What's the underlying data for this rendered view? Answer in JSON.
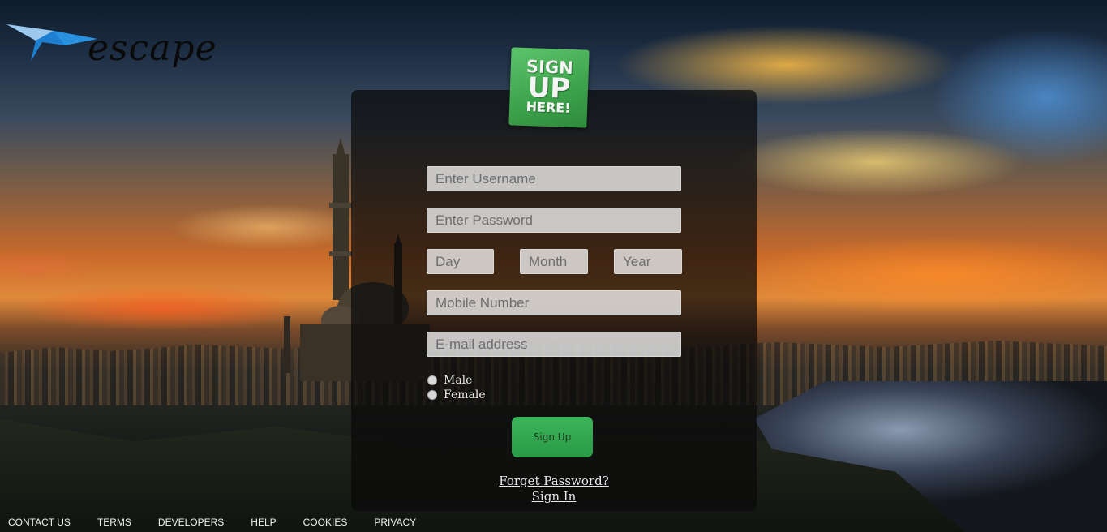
{
  "brand": {
    "name": "escape"
  },
  "badge": {
    "line1": "SIGN",
    "line2": "UP",
    "line3": "HERE!"
  },
  "form": {
    "username_placeholder": "Enter Username",
    "password_placeholder": "Enter Password",
    "day_placeholder": "Day",
    "month_placeholder": "Month",
    "year_placeholder": "Year",
    "mobile_placeholder": "Mobile Number",
    "email_placeholder": "E-mail address",
    "gender_options": [
      "Male",
      "Female"
    ],
    "submit_label": "Sign Up",
    "forget_password_link": "Forget Password?",
    "sign_in_link": "Sign In"
  },
  "footer": {
    "links": [
      "CONTACT US",
      "TERMS",
      "DEVELOPERS",
      "HELP",
      "COOKIES",
      "PRIVACY"
    ]
  },
  "colors": {
    "badge_green": "#3ca24a",
    "button_green": "#2a9a46",
    "logo_bird_blue": "#1e7fd0"
  }
}
